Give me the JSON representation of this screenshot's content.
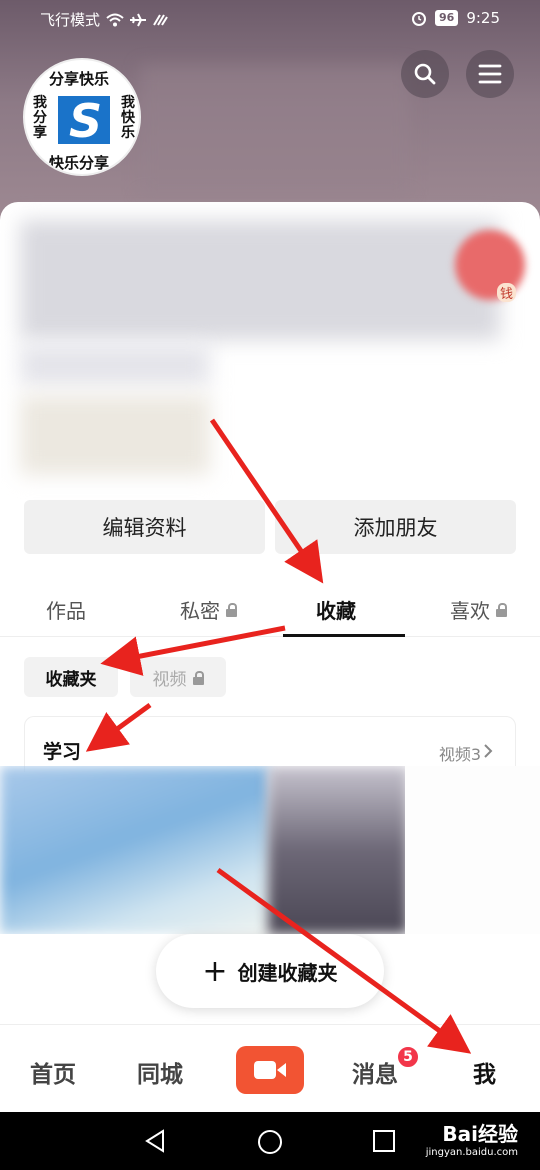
{
  "status_bar": {
    "mode": "飞行模式",
    "battery": "96",
    "time": "9:25"
  },
  "avatar": {
    "top": "分享快乐",
    "left": "我分享",
    "right": "我快乐",
    "bottom": "快乐分享",
    "logo": "S"
  },
  "profile": {
    "side_label": "钱"
  },
  "buttons": {
    "edit_profile": "编辑资料",
    "add_friend": "添加朋友"
  },
  "tabs": [
    {
      "label": "作品"
    },
    {
      "label": "私密"
    },
    {
      "label": "收藏"
    },
    {
      "label": "喜欢"
    }
  ],
  "chips": {
    "folder": "收藏夹",
    "video": "视频"
  },
  "collection": {
    "title": "学习",
    "count": "视频3"
  },
  "create": {
    "plus": "+",
    "label": "创建收藏夹"
  },
  "bottom_nav": {
    "home": "首页",
    "nearby": "同城",
    "messages": "消息",
    "messages_badge": "5",
    "me": "我"
  },
  "watermark": {
    "brand": "Bai经验",
    "url": "jingyan.baidu.com"
  },
  "colors": {
    "accent": "#f25433",
    "badge": "#f2364a",
    "arrow": "#e8231e"
  }
}
